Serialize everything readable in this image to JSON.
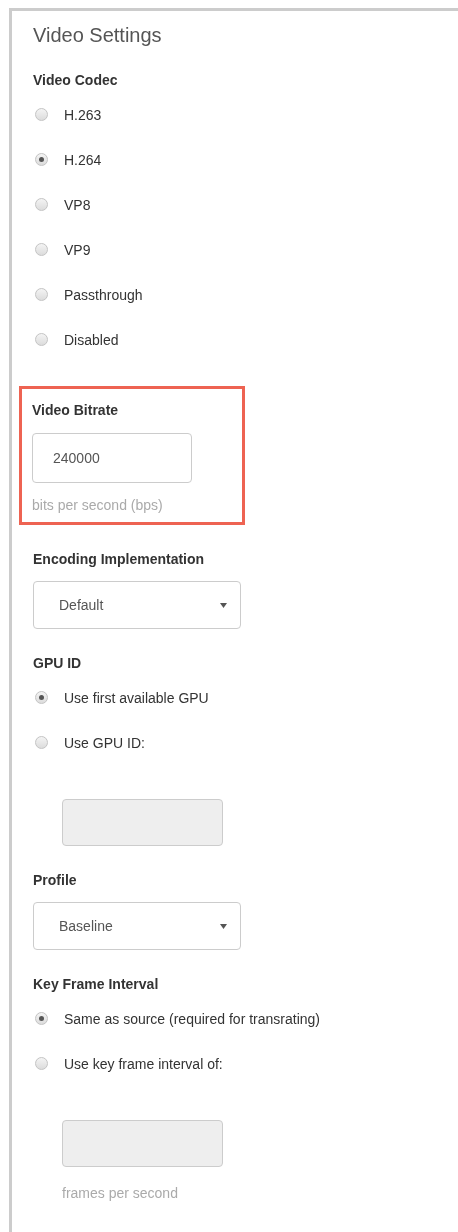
{
  "panel": {
    "title": "Video Settings"
  },
  "sections": [
    {
      "kind": "radio",
      "label": "Video Codec",
      "options": [
        {
          "label": "H.263",
          "selected": false
        },
        {
          "label": "H.264",
          "selected": true
        },
        {
          "label": "VP8",
          "selected": false
        },
        {
          "label": "VP9",
          "selected": false
        },
        {
          "label": "Passthrough",
          "selected": false
        },
        {
          "label": "Disabled",
          "selected": false
        }
      ]
    },
    {
      "kind": "field",
      "label": "Video Bitrate",
      "value": "240000",
      "hint": "bits per second (bps)",
      "highlighted": true
    },
    {
      "kind": "select",
      "label": "Encoding Implementation",
      "value": "Default"
    },
    {
      "kind": "radio",
      "label": "GPU ID",
      "options": [
        {
          "label": "Use first available GPU",
          "selected": true
        },
        {
          "label": "Use GPU ID:",
          "selected": false
        }
      ],
      "field": {
        "disabled": true
      }
    },
    {
      "kind": "select",
      "label": "Profile",
      "value": "Baseline"
    },
    {
      "kind": "radio",
      "label": "Key Frame Interval",
      "options": [
        {
          "label": "Same as source (required for transrating)",
          "selected": true
        },
        {
          "label": "Use key frame interval of:",
          "selected": false
        }
      ],
      "field": {
        "disabled": true,
        "hint": "frames per second"
      }
    }
  ]
}
